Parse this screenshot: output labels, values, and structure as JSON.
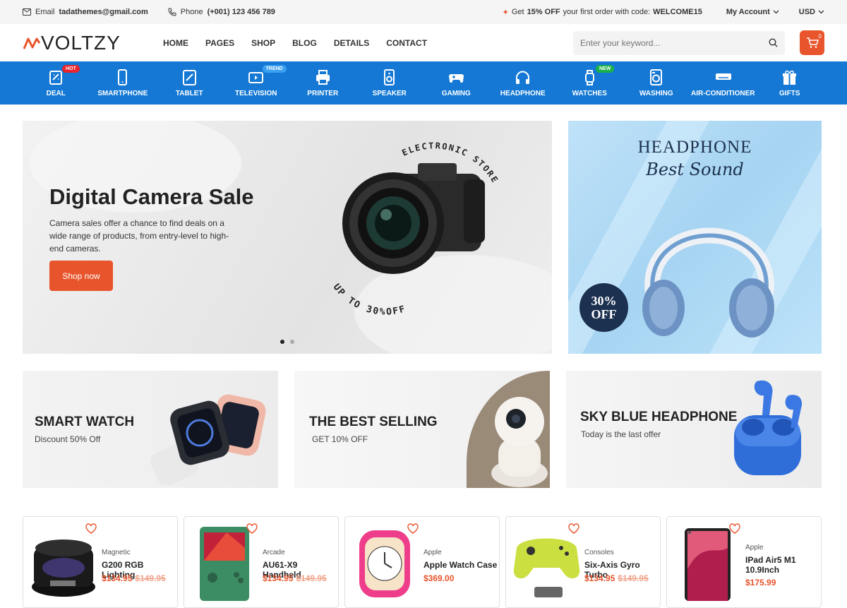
{
  "topbar": {
    "email_label": "Email",
    "email": "tadathemes@gmail.com",
    "phone_label": "Phone",
    "phone": "(+001) 123 456 789",
    "promo_prefix": "Get",
    "promo_percent": "15% OFF",
    "promo_text": "your first order with code:",
    "promo_code": "WELCOME15",
    "account": "My Account",
    "currency": "USD"
  },
  "header": {
    "logo_text": "VOLTZY",
    "nav": [
      "HOME",
      "PAGES",
      "SHOP",
      "BLOG",
      "DETAILS",
      "CONTACT"
    ],
    "search_placeholder": "Enter your keyword...",
    "cart_count": "0"
  },
  "categories": [
    {
      "label": "DEAL",
      "icon": "deal-icon",
      "badge": "HOT",
      "badge_color": "#e8242c"
    },
    {
      "label": "SMARTPHONE",
      "icon": "smartphone-icon"
    },
    {
      "label": "TABLET",
      "icon": "tablet-icon"
    },
    {
      "label": "TELEVISION",
      "icon": "television-icon",
      "badge": "TREND",
      "badge_color": "#3aa0f0"
    },
    {
      "label": "PRINTER",
      "icon": "printer-icon"
    },
    {
      "label": "SPEAKER",
      "icon": "speaker-icon"
    },
    {
      "label": "GAMING",
      "icon": "gamepad-icon"
    },
    {
      "label": "HEADPHONE",
      "icon": "headphone-icon"
    },
    {
      "label": "WATCHES",
      "icon": "watch-icon",
      "badge": "NEW",
      "badge_color": "#1ab14a"
    },
    {
      "label": "WASHING",
      "icon": "washing-machine-icon"
    },
    {
      "label": "AIR-CONDITIONER",
      "icon": "air-conditioner-icon"
    },
    {
      "label": "GIFTS",
      "icon": "gift-icon"
    }
  ],
  "hero": {
    "title": "Digital Camera Sale",
    "description": "Camera sales offer a chance to find deals on a wide range of products, from entry-level to high-end cameras.",
    "button": "Shop now",
    "arc_top": "ELECTRONIC STORE",
    "arc_bottom": "UP TO 30%OFF"
  },
  "side_banner": {
    "title": "HEADPHONE",
    "script": "Best Sound",
    "discount_line1": "30%",
    "discount_line2": "OFF"
  },
  "promos": [
    {
      "title": "SMART WATCH",
      "subtitle": "Discount 50% Off"
    },
    {
      "title": "THE BEST SELLING",
      "subtitle": "GET 10% OFF"
    },
    {
      "title": "SKY BLUE HEADPHONE",
      "subtitle": "Today is the last offer"
    }
  ],
  "products": [
    {
      "category": "Magnetic",
      "name": "G200 RGB Lighting",
      "price": "$134.95",
      "old_price": "$149.95"
    },
    {
      "category": "Arcade",
      "name": "AU61-X9 Handheld",
      "price": "$134.95",
      "old_price": "$149.95"
    },
    {
      "category": "Apple",
      "name": "Apple Watch Case",
      "price": "$369.00",
      "old_price": ""
    },
    {
      "category": "Consoles",
      "name": "Six-Axis Gyro Turbo",
      "price": "$134.95",
      "old_price": "$149.95"
    },
    {
      "category": "Apple",
      "name": "IPad Air5 M1 10.9Inch",
      "price": "$175.99",
      "old_price": ""
    }
  ],
  "colors": {
    "accent": "#e8542c",
    "category_bar": "#1478d4",
    "banner_navy": "#1c3150"
  }
}
